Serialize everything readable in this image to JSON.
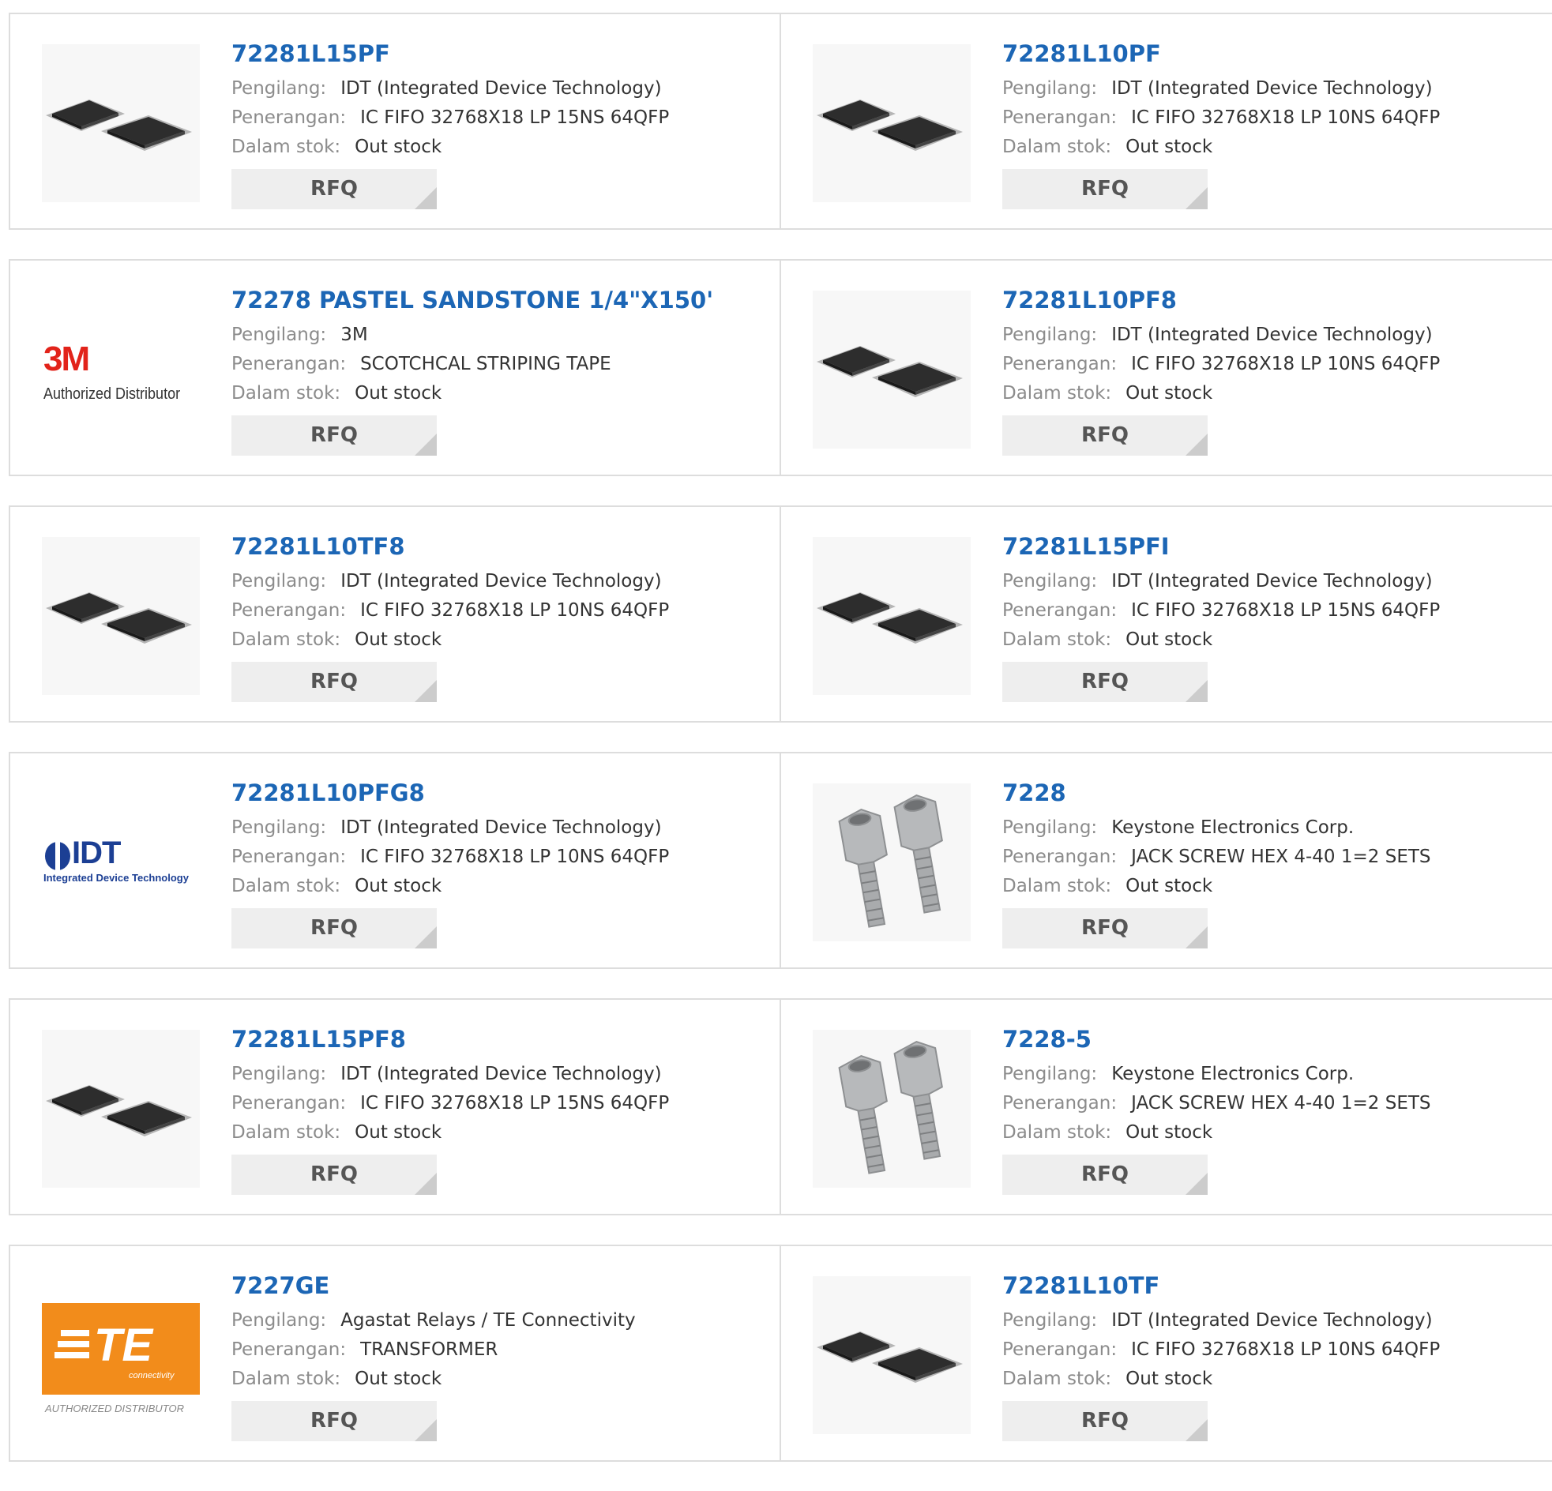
{
  "labels": {
    "manufacturer": "Pengilang:",
    "description": "Penerangan:",
    "stock": "Dalam stok:",
    "rfq": "RFQ"
  },
  "images": {
    "3m": {
      "logo_text": "3M",
      "subtitle": "Authorized Distributor",
      "color": "#e2231a"
    },
    "idt": {
      "logo_text": "IDT",
      "subtitle": "Integrated Device Technology",
      "color": "#1c3f94"
    },
    "te": {
      "logo_text": "TE",
      "subtitle": "connectivity",
      "footer": "AUTHORIZED DISTRIBUTOR",
      "color": "#f28c1b"
    }
  },
  "products": [
    {
      "part": "72281L15PF",
      "manufacturer": "IDT (Integrated Device Technology)",
      "description": "IC FIFO 32768X18 LP 15NS 64QFP",
      "stock": "Out stock",
      "image": "chip-icon"
    },
    {
      "part": "72281L10PF",
      "manufacturer": "IDT (Integrated Device Technology)",
      "description": "IC FIFO 32768X18 LP 10NS 64QFP",
      "stock": "Out stock",
      "image": "chip-icon"
    },
    {
      "part": "72278 PASTEL SANDSTONE 1/4\"X150'",
      "manufacturer": "3M",
      "description": "SCOTCHCAL STRIPING TAPE",
      "stock": "Out stock",
      "image": "3m-logo-icon"
    },
    {
      "part": "72281L10PF8",
      "manufacturer": "IDT (Integrated Device Technology)",
      "description": "IC FIFO 32768X18 LP 10NS 64QFP",
      "stock": "Out stock",
      "image": "chip-icon"
    },
    {
      "part": "72281L10TF8",
      "manufacturer": "IDT (Integrated Device Technology)",
      "description": "IC FIFO 32768X18 LP 10NS 64QFP",
      "stock": "Out stock",
      "image": "chip-icon"
    },
    {
      "part": "72281L15PFI",
      "manufacturer": "IDT (Integrated Device Technology)",
      "description": "IC FIFO 32768X18 LP 15NS 64QFP",
      "stock": "Out stock",
      "image": "chip-icon"
    },
    {
      "part": "72281L10PFG8",
      "manufacturer": "IDT (Integrated Device Technology)",
      "description": "IC FIFO 32768X18 LP 10NS 64QFP",
      "stock": "Out stock",
      "image": "idt-logo-icon"
    },
    {
      "part": "7228",
      "manufacturer": "Keystone Electronics Corp.",
      "description": "JACK SCREW HEX 4-40 1=2 SETS",
      "stock": "Out stock",
      "image": "jack-screw-icon"
    },
    {
      "part": "72281L15PF8",
      "manufacturer": "IDT (Integrated Device Technology)",
      "description": "IC FIFO 32768X18 LP 15NS 64QFP",
      "stock": "Out stock",
      "image": "chip-icon"
    },
    {
      "part": "7228-5",
      "manufacturer": "Keystone Electronics Corp.",
      "description": "JACK SCREW HEX 4-40 1=2 SETS",
      "stock": "Out stock",
      "image": "jack-screw-icon"
    },
    {
      "part": "7227GE",
      "manufacturer": "Agastat Relays / TE Connectivity",
      "description": "TRANSFORMER",
      "stock": "Out stock",
      "image": "te-logo-icon"
    },
    {
      "part": "72281L10TF",
      "manufacturer": "IDT (Integrated Device Technology)",
      "description": "IC FIFO 32768X18 LP 10NS 64QFP",
      "stock": "Out stock",
      "image": "chip-icon"
    }
  ]
}
